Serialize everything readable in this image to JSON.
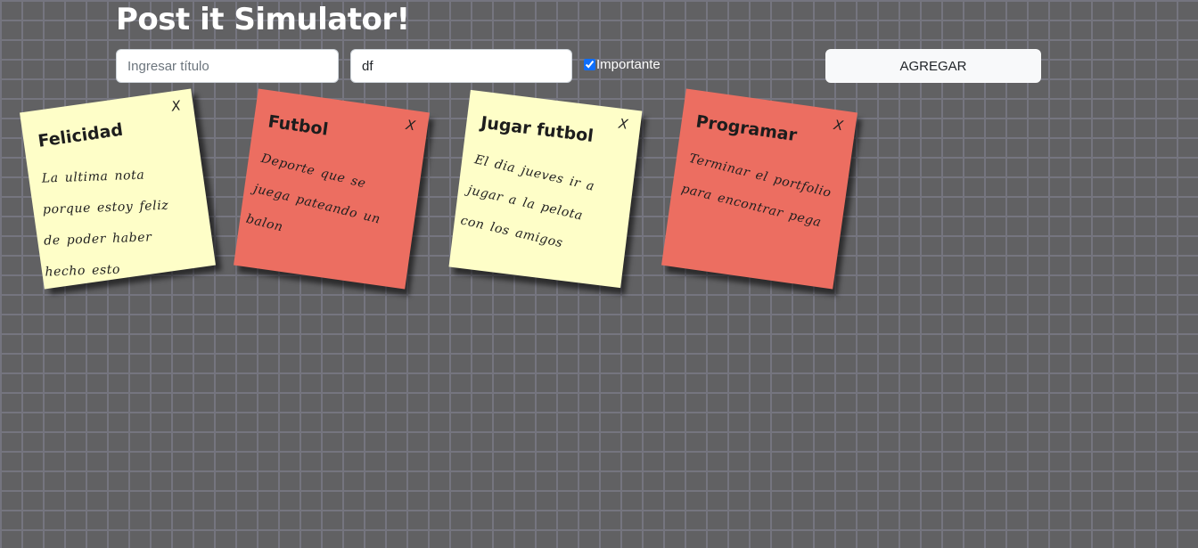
{
  "page": {
    "title": "Post it Simulator!"
  },
  "form": {
    "title_placeholder": "Ingresar título",
    "title_value": "",
    "description_value": "df",
    "important_label": "Importante",
    "important_checked": true,
    "add_label": "AGREGAR"
  },
  "notes": [
    {
      "title": "Felicidad",
      "body": "La ultima nota porque estoy feliz de poder haber hecho esto",
      "important": false,
      "close_label": "X"
    },
    {
      "title": "Futbol",
      "body": "Deporte que se juega pateando un balon",
      "important": true,
      "close_label": "X"
    },
    {
      "title": "Jugar futbol",
      "body": "El dia jueves ir a jugar a la pelota con los amigos",
      "important": false,
      "close_label": "X"
    },
    {
      "title": "Programar",
      "body": "Terminar el portfolio para encontrar pega",
      "important": true,
      "close_label": "X"
    }
  ],
  "colors": {
    "background": "#616163",
    "note_normal": "#fefec8",
    "note_important": "#ec6e61"
  }
}
